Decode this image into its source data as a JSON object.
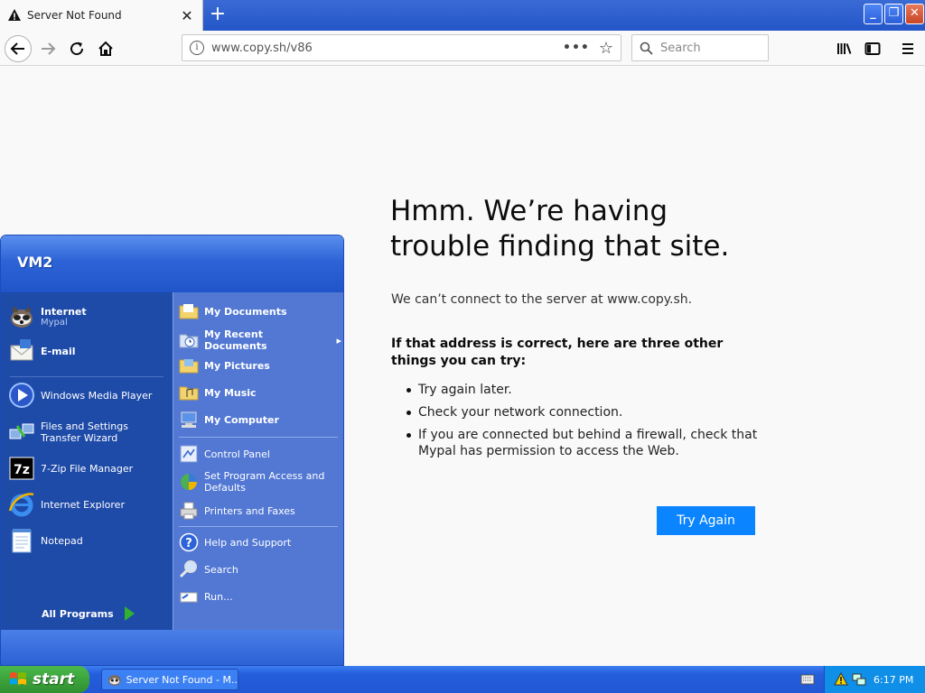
{
  "browser": {
    "tab_title": "Server Not Found",
    "url": "www.copy.sh/v86",
    "search_placeholder": "Search",
    "accent": "#0a84ff"
  },
  "error_page": {
    "title": "Hmm. We’re having trouble finding that site.",
    "description": "We can’t connect to the server at www.copy.sh.",
    "subtitle": "If that address is correct, here are three other things you can try:",
    "suggestions": [
      "Try again later.",
      "Check your network connection.",
      "If you are connected but behind a firewall, check that Mypal has permission to access the Web."
    ],
    "try_again_label": "Try Again"
  },
  "start_menu": {
    "user": "VM2",
    "pinned": [
      {
        "label": "Internet",
        "sub": "Mypal",
        "icon": "mypal-icon"
      },
      {
        "label": "E-mail",
        "icon": "email-icon"
      }
    ],
    "recent": [
      {
        "label": "Windows Media Player",
        "icon": "media-player-icon"
      },
      {
        "label": "Files and Settings Transfer Wizard",
        "icon": "transfer-wizard-icon"
      },
      {
        "label": "7-Zip File Manager",
        "icon": "7zip-icon"
      },
      {
        "label": "Internet Explorer",
        "icon": "ie-icon"
      },
      {
        "label": "Notepad",
        "icon": "notepad-icon"
      }
    ],
    "all_programs": "All Programs",
    "places": [
      {
        "label": "My Documents",
        "icon": "folder-icon"
      },
      {
        "label": "My Recent Documents",
        "icon": "recent-docs-icon"
      },
      {
        "label": "My Pictures",
        "icon": "folder-icon"
      },
      {
        "label": "My Music",
        "icon": "folder-icon"
      },
      {
        "label": "My Computer",
        "icon": "computer-icon"
      }
    ],
    "system": [
      {
        "label": "Control Panel",
        "icon": "control-panel-icon"
      },
      {
        "label": "Set Program Access and Defaults",
        "icon": "program-access-icon"
      },
      {
        "label": "Printers and Faxes",
        "icon": "printer-icon"
      }
    ],
    "help": [
      {
        "label": "Help and Support",
        "icon": "help-icon"
      },
      {
        "label": "Search",
        "icon": "search-icon"
      },
      {
        "label": "Run...",
        "icon": "run-icon"
      }
    ]
  },
  "taskbar": {
    "start_label": "start",
    "task_label": "Server Not Found - M...",
    "clock": "6:17 PM"
  }
}
